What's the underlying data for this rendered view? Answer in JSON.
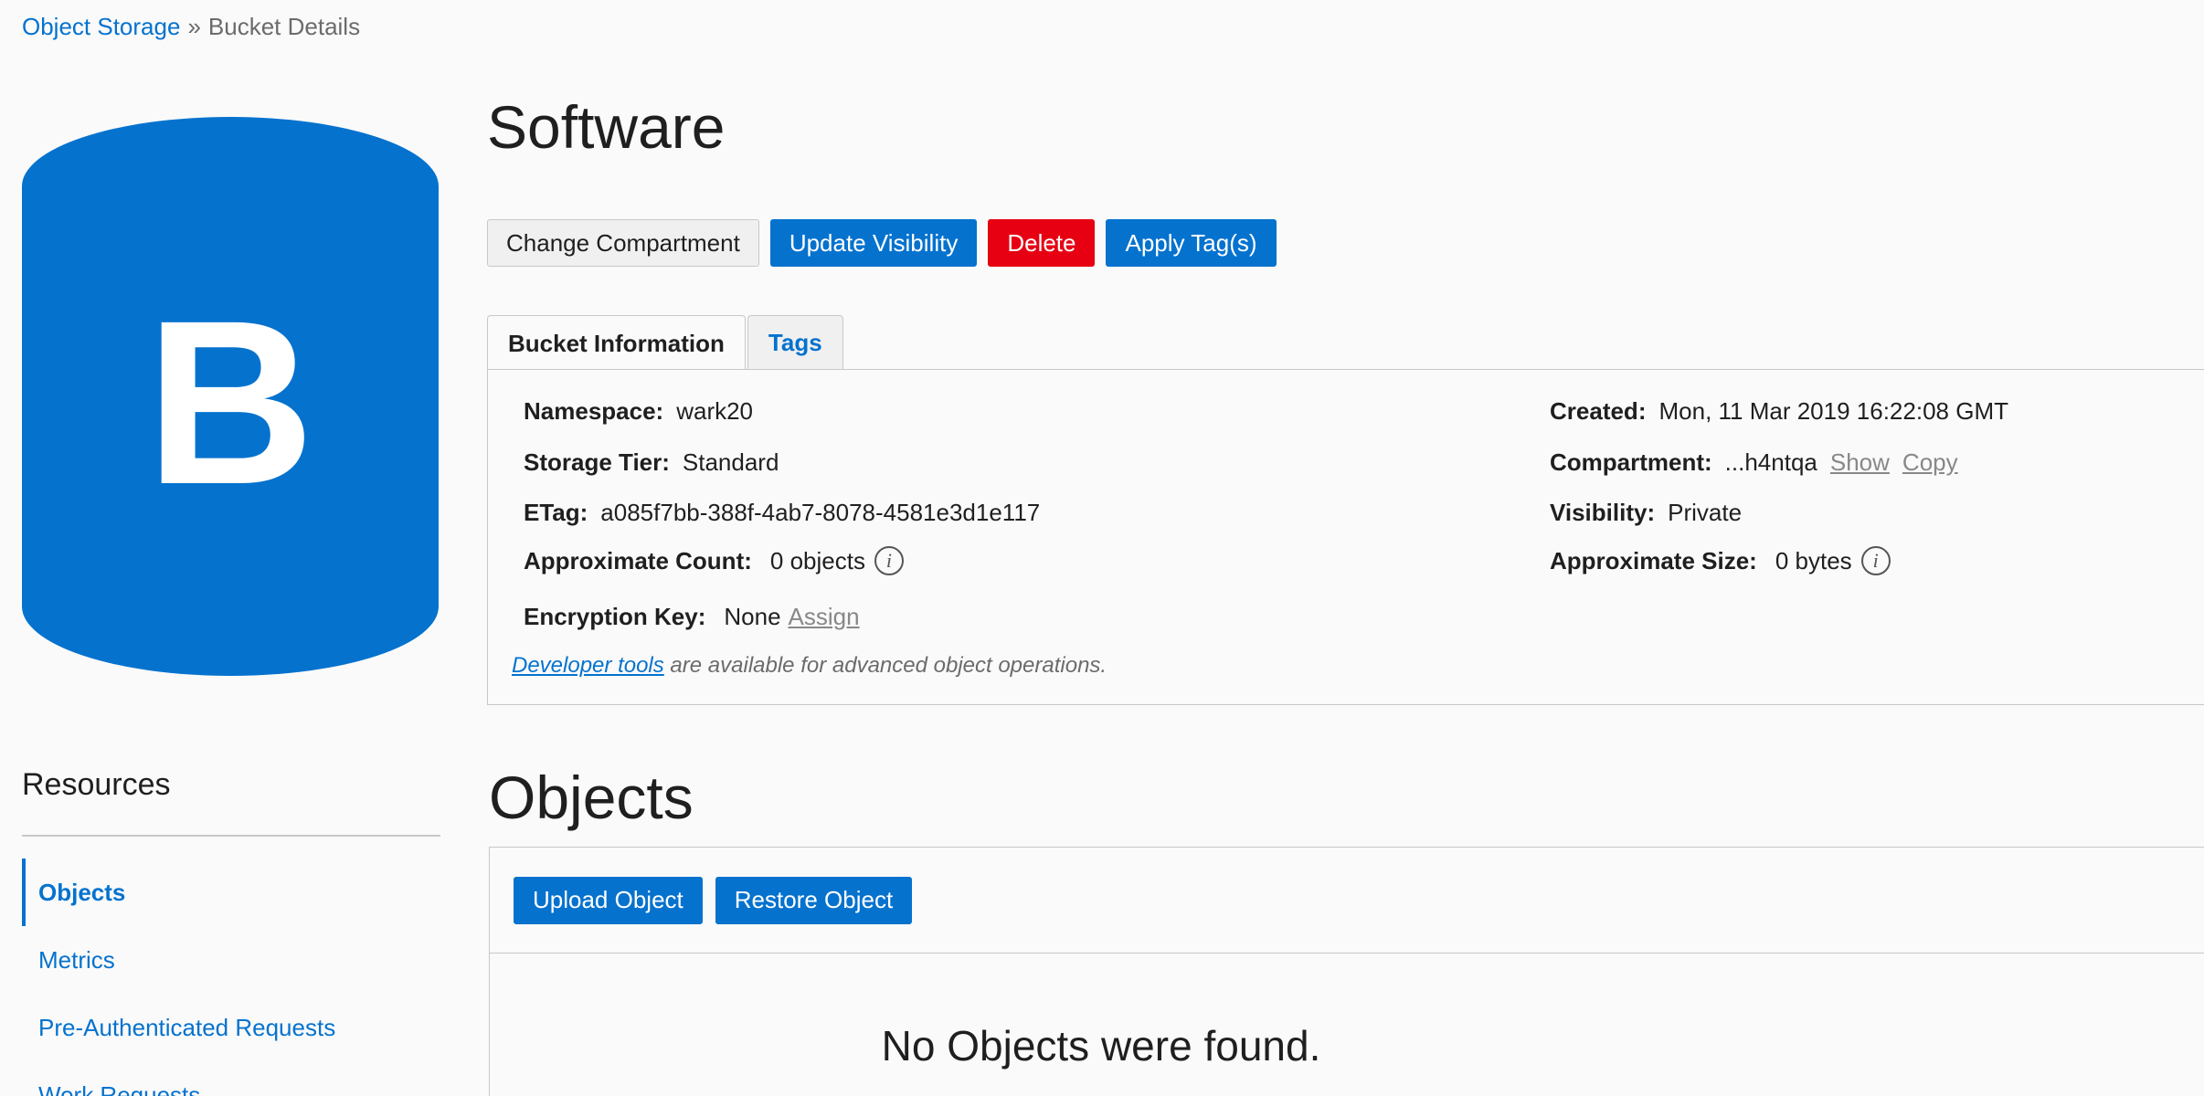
{
  "breadcrumb": {
    "root": "Object Storage",
    "separator": "»",
    "current": "Bucket Details"
  },
  "bucket": {
    "letter": "B",
    "name": "Software",
    "color": "#0572ce"
  },
  "actions": {
    "change_compartment": "Change Compartment",
    "update_visibility": "Update Visibility",
    "delete": "Delete",
    "apply_tags": "Apply Tag(s)"
  },
  "tabs": {
    "bucket_information": "Bucket Information",
    "tags": "Tags"
  },
  "info": {
    "namespace": {
      "label": "Namespace:",
      "value": "wark20"
    },
    "storage_tier": {
      "label": "Storage Tier:",
      "value": "Standard"
    },
    "etag": {
      "label": "ETag:",
      "value": "a085f7bb-388f-4ab7-8078-4581e3d1e117"
    },
    "approx_count": {
      "label": "Approximate Count:",
      "value": "0 objects"
    },
    "encryption_key": {
      "label": "Encryption Key:",
      "value": "None",
      "assign": "Assign"
    },
    "created": {
      "label": "Created:",
      "value": "Mon, 11 Mar 2019 16:22:08 GMT"
    },
    "compartment": {
      "label": "Compartment:",
      "value": "...h4ntqa",
      "show": "Show",
      "copy": "Copy"
    },
    "visibility": {
      "label": "Visibility:",
      "value": "Private"
    },
    "approx_size": {
      "label": "Approximate Size:",
      "value": "0 bytes"
    },
    "info_icon_glyph": "i",
    "dev_tools_link": "Developer tools",
    "dev_tools_text": " are available for advanced object operations."
  },
  "resources": {
    "title": "Resources",
    "items": [
      {
        "label": "Objects",
        "active": true
      },
      {
        "label": "Metrics",
        "active": false
      },
      {
        "label": "Pre-Authenticated Requests",
        "active": false
      },
      {
        "label": "Work Requests",
        "active": false
      }
    ]
  },
  "objects": {
    "title": "Objects",
    "upload_button": "Upload Object",
    "restore_button": "Restore Object",
    "empty_message": "No Objects were found."
  }
}
